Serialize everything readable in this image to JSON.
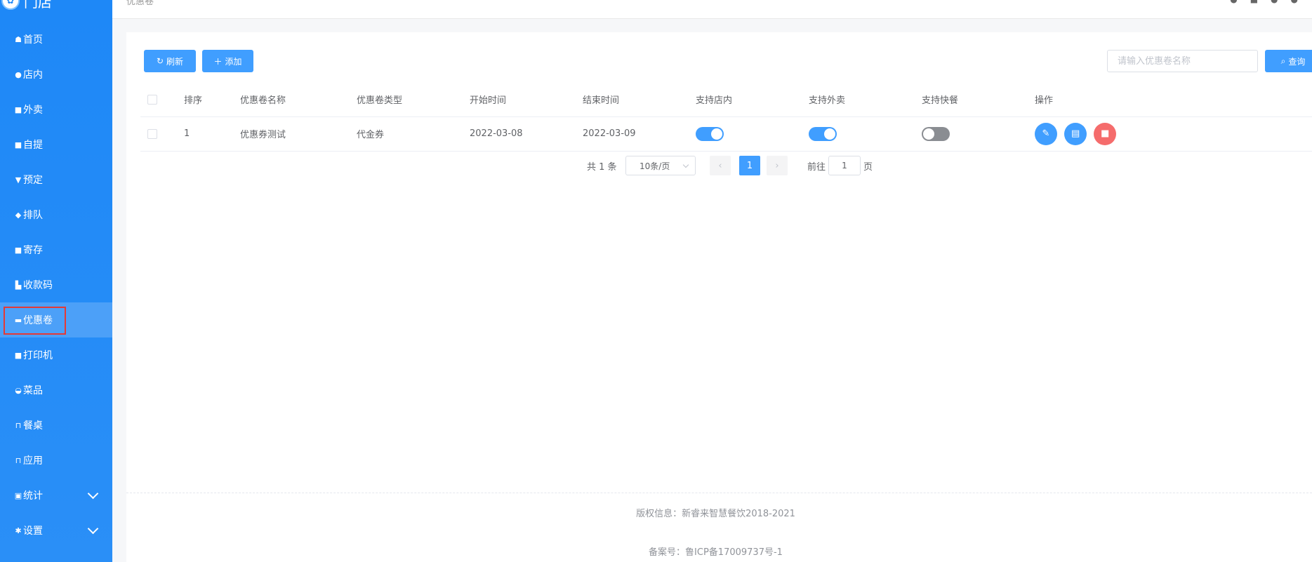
{
  "brand": {
    "name": "门店",
    "logo_icon": "app-logo"
  },
  "sidebar": {
    "items": [
      {
        "label": "首页",
        "icon": "home-icon"
      },
      {
        "label": "店内",
        "icon": "user-icon"
      },
      {
        "label": "外卖",
        "icon": "delivery-icon"
      },
      {
        "label": "自提",
        "icon": "bag-icon"
      },
      {
        "label": "预定",
        "icon": "cup-icon"
      },
      {
        "label": "排队",
        "icon": "queue-icon"
      },
      {
        "label": "寄存",
        "icon": "storage-icon"
      },
      {
        "label": "收款码",
        "icon": "payment-code-icon"
      },
      {
        "label": "优惠卷",
        "icon": "coupon-icon",
        "active": true
      },
      {
        "label": "打印机",
        "icon": "printer-icon"
      },
      {
        "label": "菜品",
        "icon": "dish-icon"
      },
      {
        "label": "餐桌",
        "icon": "table-icon"
      },
      {
        "label": "应用",
        "icon": "app-icon"
      },
      {
        "label": "统计",
        "icon": "stats-icon",
        "expandable": true
      },
      {
        "label": "设置",
        "icon": "settings-icon",
        "expandable": true
      }
    ]
  },
  "topbar": {
    "breadcrumb": "优惠卷"
  },
  "toolbar": {
    "refresh_label": "刷新",
    "add_label": "添加",
    "search_placeholder": "请输入优惠卷名称",
    "query_label": "查询"
  },
  "table": {
    "headers": [
      "排序",
      "优惠卷名称",
      "优惠卷类型",
      "开始时间",
      "结束时间",
      "支持店内",
      "支持外卖",
      "支持快餐",
      "操作"
    ],
    "rows": [
      {
        "sort": "1",
        "name": "优惠券测试",
        "type": "代金券",
        "start": "2022-03-08",
        "end": "2022-03-09",
        "dine_in": true,
        "takeout": true,
        "fast_food": false
      }
    ]
  },
  "pagination": {
    "total": "共 1 条",
    "page_size": "10条/页",
    "current_page": "1",
    "goto_label": "前往",
    "goto_value": "1",
    "page_suffix": "页"
  },
  "footer": {
    "copyright": "版权信息：新睿来智慧餐饮2018-2021",
    "icp": "备案号：鲁ICP备17009737号-1"
  },
  "colors": {
    "primary": "#409eff",
    "danger": "#f56c6c",
    "sidebar": "#1e88f7"
  }
}
